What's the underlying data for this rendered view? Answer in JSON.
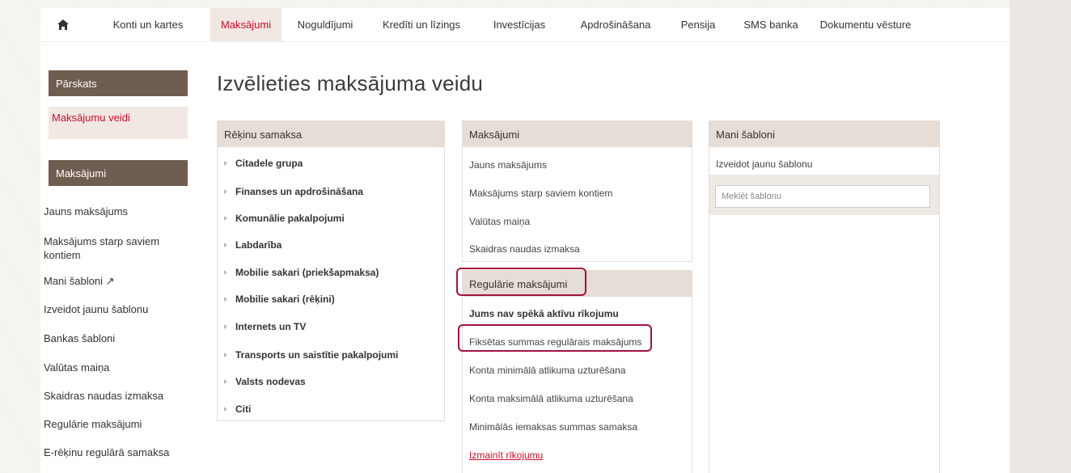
{
  "nav": {
    "items": [
      "Konti un kartes",
      "Maksājumi",
      "Noguldījumi",
      "Kredīti un līzings",
      "Investīcijas",
      "Apdrošināšana",
      "Pensija",
      "SMS banka",
      "Dokumentu vēsture"
    ],
    "active": "Maksājumi"
  },
  "sidebar": {
    "overview_header": "Pārskats",
    "overview_selected": "Maksājumu veidi",
    "payments_header": "Maksājumi",
    "items": [
      "Jauns maksājums",
      "Maksājums starp saviem kontiem",
      "Mani šabloni ↗",
      "Izveidot jaunu šablonu",
      "Bankas šabloni",
      "Valūtas maiņa",
      "Skaidras naudas izmaksa",
      "Regulārie maksājumi",
      "E-rēķinu regulārā samaksa"
    ]
  },
  "main": {
    "title": "Izvēlieties maksājuma veidu",
    "bills": {
      "header": "Rēķinu samaksa",
      "items": [
        "Citadele grupa",
        "Finanses un apdrošināšana",
        "Komunālie pakalpojumi",
        "Labdarība",
        "Mobilie sakari (priekšapmaksa)",
        "Mobilie sakari (rēķini)",
        "Internets un TV",
        "Transports un saistītie pakalpojumi",
        "Valsts nodevas",
        "Citi"
      ]
    },
    "payments": {
      "header": "Maksājumi",
      "items": [
        "Jauns maksājums",
        "Maksājums starp saviem kontiem",
        "Valūtas maiņa",
        "Skaidras naudas izmaksa"
      ]
    },
    "regular": {
      "header": "Regulārie maksājumi",
      "notice": "Jums nav spēkā aktīvu rīkojumu",
      "items": [
        "Fiksētas summas regulārais maksājums",
        "Konta minimālā atlikuma uzturēšana",
        "Konta maksimālā atlikuma uzturēšana",
        "Minimālās iemaksas summas samaksa"
      ],
      "change_link": "Izmainīt rīkojumu"
    },
    "templates": {
      "header": "Mani šabloni",
      "create": "Izveidot jaunu šablonu",
      "search_placeholder": "Meklēt šablonu"
    }
  },
  "colors": {
    "accent": "#c8102e",
    "sidebar_header": "#6f5d52",
    "panel_header": "#e6ddd6",
    "selected_bg": "#f1e7e3",
    "highlight": "#a4133c"
  }
}
